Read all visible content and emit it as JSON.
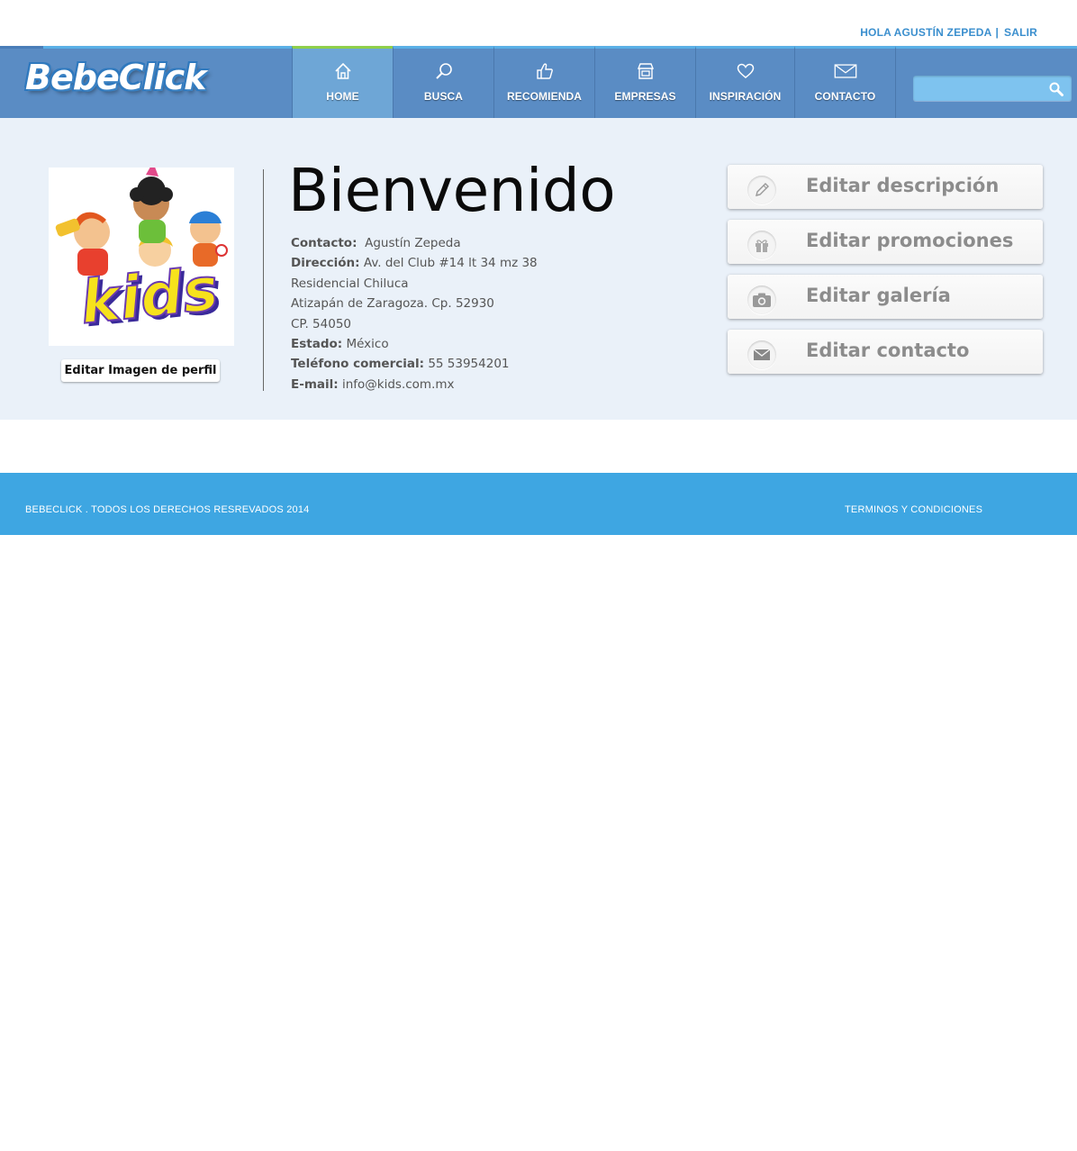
{
  "header": {
    "greeting": "HOLA AGUSTÍN ZEPEDA",
    "separator": "|",
    "logout_label": "SALIR"
  },
  "brand": {
    "logo_text": "BebeClick",
    "colors": {
      "nav_bg": "#5a8cc4",
      "nav_active": "#6ea6d6",
      "active_indicator": "#8fcf4a",
      "accent": "#3b8fce",
      "footer_bg": "#3ea6e2",
      "main_bg": "#eaf1f9"
    }
  },
  "nav": {
    "items": [
      {
        "label": "HOME",
        "icon": "home-icon",
        "active": true
      },
      {
        "label": "BUSCA",
        "icon": "search-icon",
        "active": false
      },
      {
        "label": "RECOMIENDA",
        "icon": "thumbs-up-icon",
        "active": false
      },
      {
        "label": "EMPRESAS",
        "icon": "store-icon",
        "active": false
      },
      {
        "label": "INSPIRACIÓN",
        "icon": "heart-icon",
        "active": false
      },
      {
        "label": "CONTACTO",
        "icon": "envelope-icon",
        "active": false
      }
    ],
    "search": {
      "value": "",
      "placeholder": ""
    }
  },
  "profile": {
    "image_caption": "kids",
    "edit_image_label": "Editar Imagen de perfil",
    "welcome": "Bienvenido",
    "fields": {
      "contact_label": "Contacto:",
      "contact_value": "Agustín Zepeda",
      "address_label": "Dirección:",
      "address_line1": "Av. del Club #14 lt 34 mz 38",
      "address_line2": "Residencial Chiluca",
      "address_line3": "Atizapán de Zaragoza. Cp. 52930",
      "address_line4": "CP. 54050",
      "state_label": "Estado:",
      "state_value": "México",
      "phone_label": "Teléfono comercial:",
      "phone_value": "55 53954201",
      "email_label": "E-mail:",
      "email_value": "info@kids.com.mx"
    }
  },
  "actions": [
    {
      "label": "Editar descripción",
      "icon": "pencil-icon"
    },
    {
      "label": "Editar promociones",
      "icon": "gift-icon"
    },
    {
      "label": "Editar  galería",
      "icon": "camera-icon"
    },
    {
      "label": "Editar contacto",
      "icon": "mail-icon"
    }
  ],
  "footer": {
    "copyright": "BEBECLICK . TODOS LOS DERECHOS RESREVADOS 2014",
    "terms": "TERMINOS Y CONDICIONES"
  }
}
